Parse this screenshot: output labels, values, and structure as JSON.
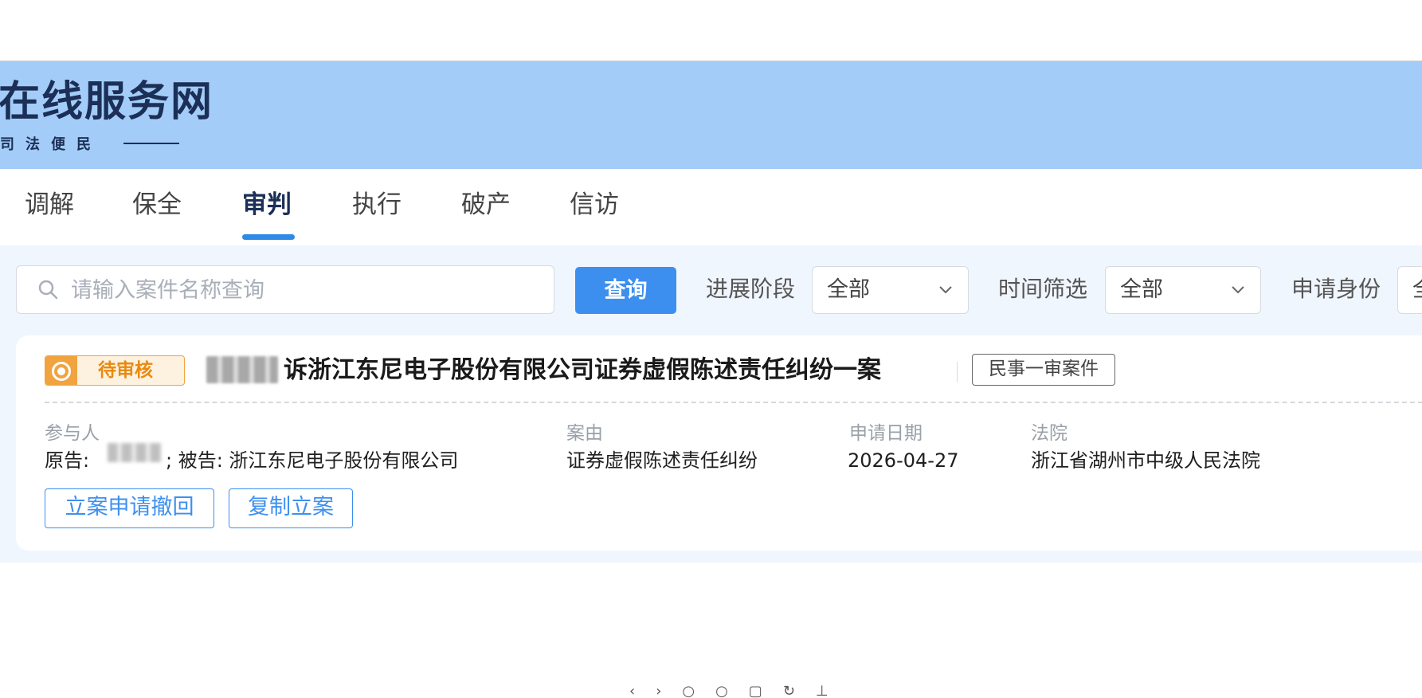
{
  "header": {
    "title": "在线服务网",
    "subtitle": "司法便民"
  },
  "tabs": [
    {
      "label": "调解"
    },
    {
      "label": "保全"
    },
    {
      "label": "审判"
    },
    {
      "label": "执行"
    },
    {
      "label": "破产"
    },
    {
      "label": "信访"
    }
  ],
  "active_tab": "审判",
  "filters": {
    "search_placeholder": "请输入案件名称查询",
    "search_value": "",
    "query_button": "查询",
    "stage_label": "进展阶段",
    "stage_value": "全部",
    "time_label": "时间筛选",
    "time_value": "全部",
    "identity_label": "申请身份",
    "identity_value": "全"
  },
  "case": {
    "status": "待审核",
    "title": "诉浙江东尼电子股份有限公司证券虚假陈述责任纠纷一案",
    "type": "民事一审案件",
    "participants_label": "参与人",
    "participants_plaintiff_label": "原告:",
    "participants_defendant": "; 被告: 浙江东尼电子股份有限公司",
    "cause_label": "案由",
    "cause_value": "证券虚假陈述责任纠纷",
    "date_label": "申请日期",
    "date_value": "2026-04-27",
    "court_label": "法院",
    "court_value": "浙江省湖州市中级人民法院",
    "withdraw_button": "立案申请撤回",
    "copy_button": "复制立案"
  },
  "colors": {
    "banner": "#a3cdf8",
    "accent": "#3d8fef",
    "status_orange": "#f1a340",
    "page_background": "#f0f6fd"
  }
}
